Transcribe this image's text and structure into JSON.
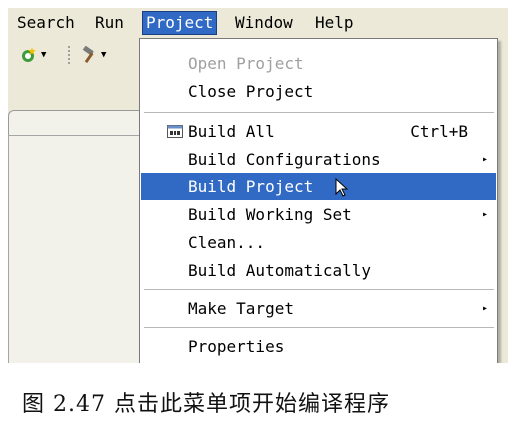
{
  "menubar": {
    "items": [
      {
        "label": "Search"
      },
      {
        "label": "Run"
      },
      {
        "label": "Project"
      },
      {
        "label": "Window"
      },
      {
        "label": "Help"
      }
    ]
  },
  "toolbar": {
    "icons": [
      "new-project-wizard-icon",
      "dropdown-arrow-icon",
      "build-hammer-icon",
      "dropdown-arrow-icon"
    ]
  },
  "project_menu": {
    "items": [
      {
        "label": "Open Project",
        "state": "disabled"
      },
      {
        "label": "Close Project"
      },
      {
        "label": "Build All",
        "accelerator": "Ctrl+B",
        "icon": "build-all-icon"
      },
      {
        "label": "Build Configurations",
        "submenu": "▸"
      },
      {
        "label": "Build Project",
        "state": "selected"
      },
      {
        "label": "Build Working Set",
        "submenu": "▸"
      },
      {
        "label": "Clean..."
      },
      {
        "label": "Build Automatically"
      },
      {
        "label": "Make Target",
        "submenu": "▸"
      },
      {
        "label": "Properties"
      }
    ]
  },
  "caption": "图 2.47 点击此菜单项开始编译程序",
  "colors": {
    "selection": "#316ac5",
    "chrome": "#ece9d8",
    "disabled_text": "#a0a0a0"
  }
}
